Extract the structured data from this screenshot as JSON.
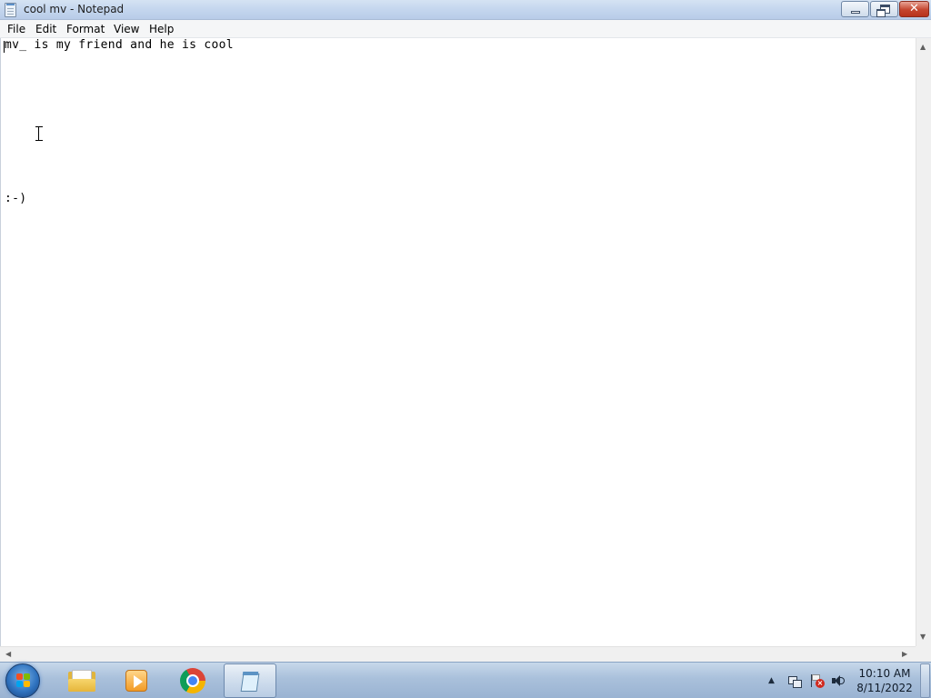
{
  "window": {
    "title": "cool mv - Notepad",
    "close_glyph": "✕"
  },
  "menu": {
    "items": [
      "File",
      "Edit",
      "Format",
      "View",
      "Help"
    ]
  },
  "document": {
    "lines": [
      "mv_ is my friend and he is cool",
      ":-)"
    ]
  },
  "scrollbar": {
    "up_glyph": "▲",
    "down_glyph": "▼",
    "left_glyph": "◀",
    "right_glyph": "▶"
  },
  "taskbar": {
    "pinned": [
      {
        "name": "Windows Explorer",
        "icon": "folder-icon"
      },
      {
        "name": "Windows Media Player",
        "icon": "media-player-icon"
      },
      {
        "name": "Google Chrome",
        "icon": "chrome-icon"
      },
      {
        "name": "Notepad",
        "icon": "notepad-icon",
        "active": true
      }
    ],
    "tray_arrow": "▲",
    "clock": {
      "time": "10:10 AM",
      "date": "8/11/2022"
    }
  },
  "colors": {
    "title_bar": "#c4d6ee",
    "taskbar": "#a9c0db",
    "close_button": "#c4452e",
    "editor_bg": "#ffffff"
  }
}
